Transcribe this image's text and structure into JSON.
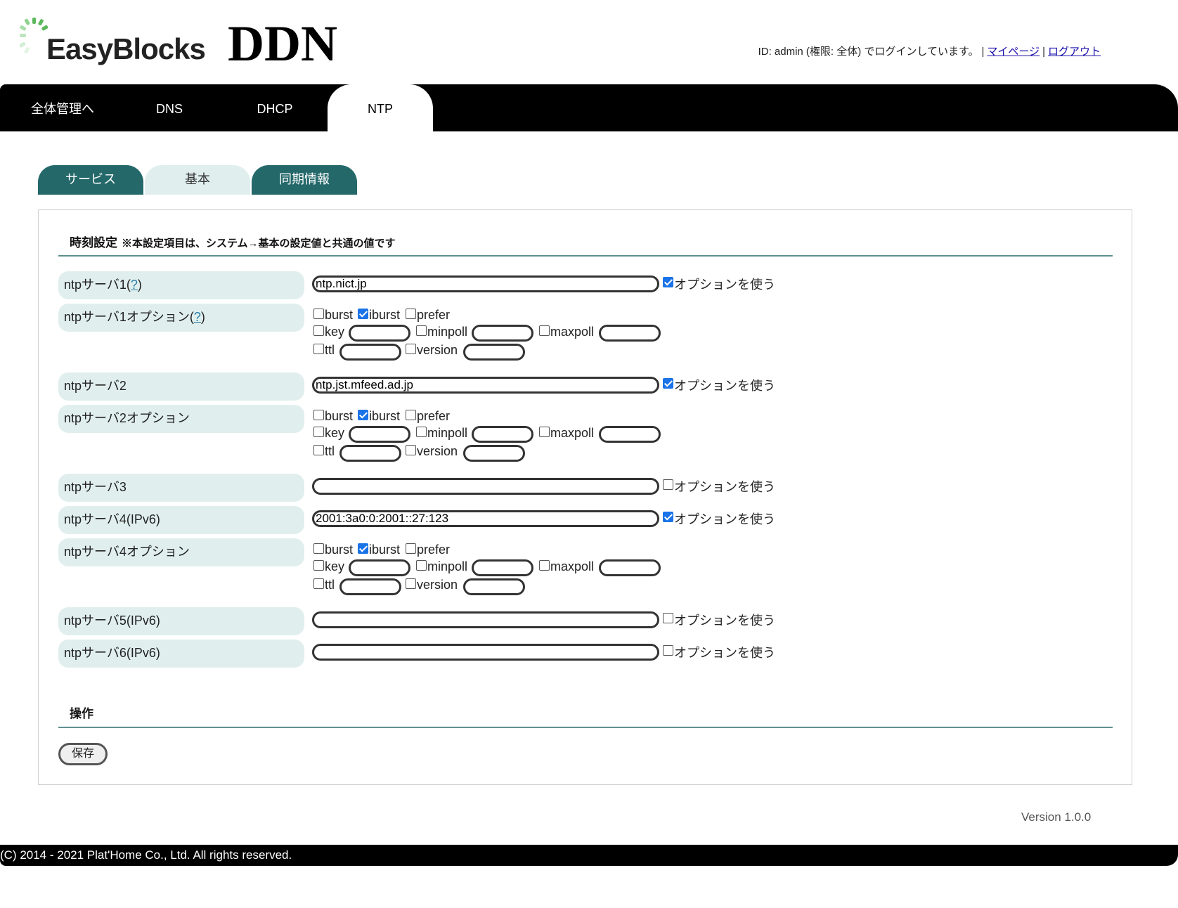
{
  "header": {
    "logo_text": "EasyBlocks",
    "product": "DDN",
    "login_text": "ID: admin (権限: 全体) でログインしています。",
    "mypage_link": "マイページ",
    "logout_link": "ログアウト",
    "separator": "|"
  },
  "nav": {
    "items": [
      {
        "label": "全体管理へ"
      },
      {
        "label": "DNS"
      },
      {
        "label": "DHCP"
      },
      {
        "label": "NTP"
      }
    ]
  },
  "subtabs": [
    {
      "label": "サービス"
    },
    {
      "label": "基本"
    },
    {
      "label": "同期情報"
    }
  ],
  "time_section": {
    "title": "時刻設定",
    "note": "※本設定項目は、システム→基本の設定値と共通の値です"
  },
  "help_mark": "?",
  "use_option_label": "オプションを使う",
  "option_labels": {
    "burst": "burst",
    "iburst": "iburst",
    "prefer": "prefer",
    "key": "key",
    "minpoll": "minpoll",
    "maxpoll": "maxpoll",
    "ttl": "ttl",
    "version": "version"
  },
  "servers": [
    {
      "label": "ntpサーバ1(",
      "label_end": ")",
      "value": "ntp.nict.jp",
      "use_option": true
    },
    {
      "label": "ntpサーバ2",
      "value": "ntp.jst.mfeed.ad.jp",
      "use_option": true
    },
    {
      "label": "ntpサーバ3",
      "value": "",
      "use_option": false
    },
    {
      "label": "ntpサーバ4(IPv6)",
      "value": "2001:3a0:0:2001::27:123",
      "use_option": true
    },
    {
      "label": "ntpサーバ5(IPv6)",
      "value": "",
      "use_option": false
    },
    {
      "label": "ntpサーバ6(IPv6)",
      "value": "",
      "use_option": false
    }
  ],
  "option_rows": [
    {
      "label": "ntpサーバ1オプション(",
      "label_end": ")",
      "burst": false,
      "iburst": true,
      "prefer": false
    },
    {
      "label": "ntpサーバ2オプション",
      "burst": false,
      "iburst": true,
      "prefer": false
    },
    {
      "label": "ntpサーバ4オプション",
      "burst": false,
      "iburst": true,
      "prefer": false
    }
  ],
  "operation": {
    "title": "操作",
    "save_label": "保存"
  },
  "version": "Version 1.0.0",
  "footer": {
    "copyright": "(C) 2014 - 2021 Plat'Home Co., Ltd. All rights reserved."
  }
}
